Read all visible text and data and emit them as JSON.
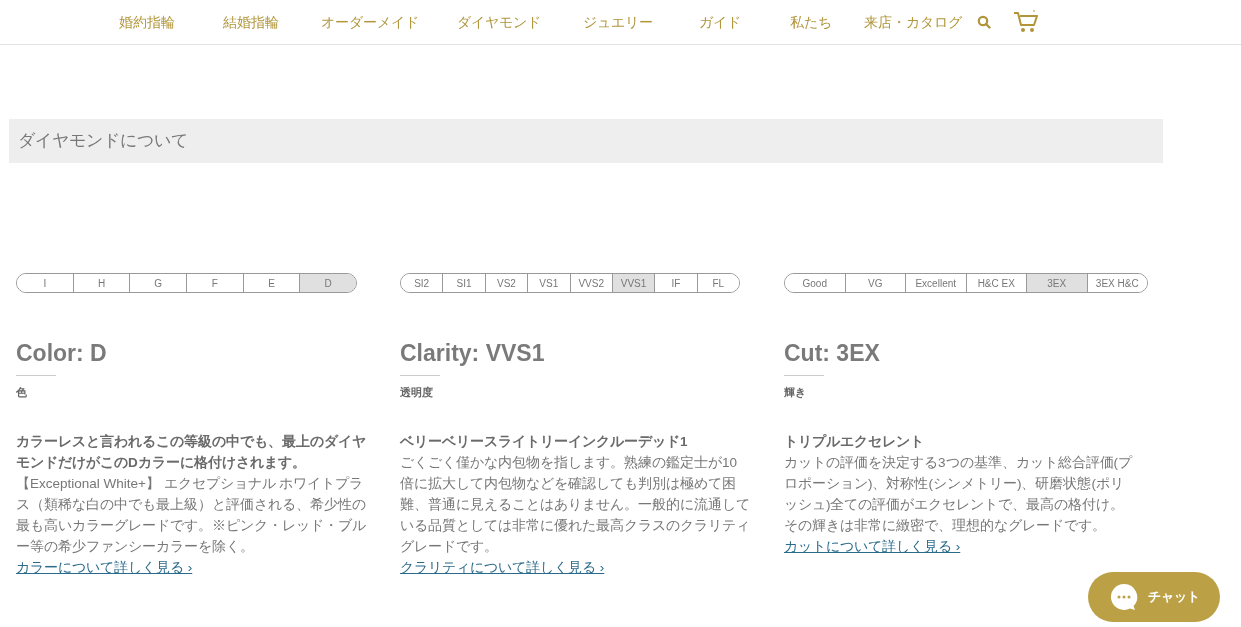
{
  "nav": {
    "items": [
      "婚約指輪",
      "結婚指輪",
      "オーダーメイド",
      "ダイヤモンド",
      "ジュエリー",
      "ガイド",
      "私たち",
      "来店・カタログ"
    ]
  },
  "section_title": "ダイヤモンドについて",
  "grades": [
    {
      "scale": [
        {
          "label": "I",
          "selected": false
        },
        {
          "label": "H",
          "selected": false
        },
        {
          "label": "G",
          "selected": false
        },
        {
          "label": "F",
          "selected": false
        },
        {
          "label": "E",
          "selected": false
        },
        {
          "label": "D",
          "selected": true
        }
      ],
      "title": "Color: D",
      "subtitle": "色",
      "lead": "カラーレスと言われるこの等級の中でも、最上のダイヤモンドだけがこのDカラーに格付けされます。",
      "body": "【Exceptional White+】 エクセプショナル ホワイトプラス（類稀な白の中でも最上級）と評価される、希少性の最も高いカラーグレードです。※ピンク・レッド・ブルー等の希少ファンシーカラーを除く。",
      "link": "カラーについて詳しく見る ›"
    },
    {
      "scale": [
        {
          "label": "SI2",
          "selected": false
        },
        {
          "label": "SI1",
          "selected": false
        },
        {
          "label": "VS2",
          "selected": false
        },
        {
          "label": "VS1",
          "selected": false
        },
        {
          "label": "VVS2",
          "selected": false
        },
        {
          "label": "VVS1",
          "selected": true
        },
        {
          "label": "IF",
          "selected": false
        },
        {
          "label": "FL",
          "selected": false
        }
      ],
      "title": "Clarity: VVS1",
      "subtitle": "透明度",
      "lead": "ベリーベリースライトリーインクルーデッド1",
      "body": "ごくごく僅かな内包物を指します。熟練の鑑定士が10倍に拡大して内包物などを確認しても判別は極めて困難、普通に見えることはありません。一般的に流通している品質としては非常に優れた最高クラスのクラリティグレードです。",
      "link": "クラリティについて詳しく見る ›"
    },
    {
      "scale": [
        {
          "label": "Good",
          "selected": false
        },
        {
          "label": "VG",
          "selected": false
        },
        {
          "label": "Excellent",
          "selected": false
        },
        {
          "label": "H&C EX",
          "selected": false
        },
        {
          "label": "3EX",
          "selected": true
        },
        {
          "label": "3EX H&C",
          "selected": false
        }
      ],
      "title": "Cut: 3EX",
      "subtitle": "輝き",
      "lead": "トリプルエクセレント",
      "body": "カットの評価を決定する3つの基準、カット総合評価(プロポーション)、対称性(シンメトリー)、研磨状態(ポリッシュ)全ての評価がエクセレントで、最高の格付け。その輝きは非常に緻密で、理想的なグレードです。",
      "link": "カットについて詳しく見る ›"
    }
  ],
  "chat": {
    "label": "チャット"
  }
}
